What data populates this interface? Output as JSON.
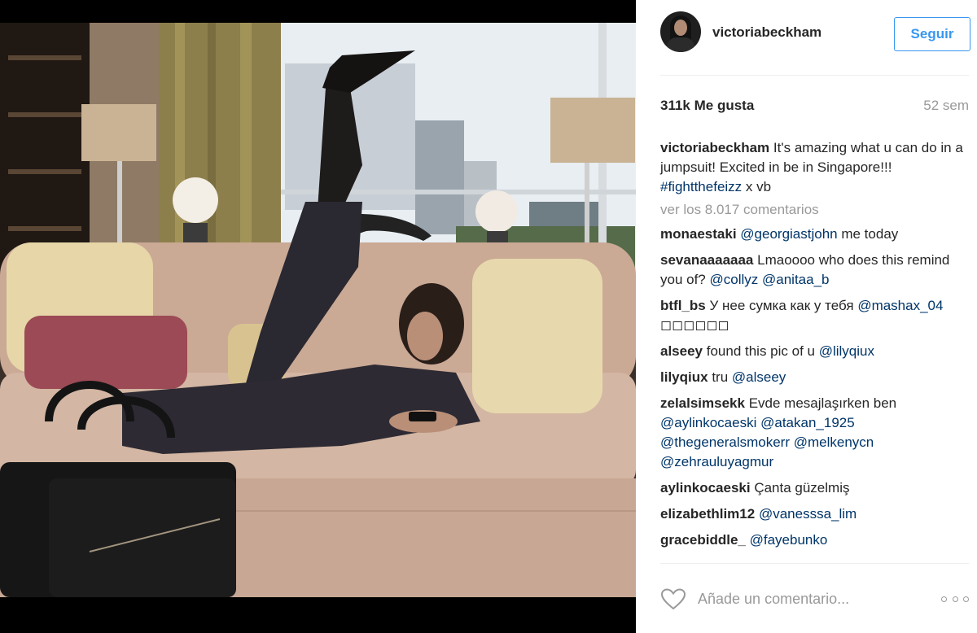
{
  "post": {
    "photo_alt": "Woman lying on a sofa with one leg raised, looking at her phone",
    "username": "victoriabeckham",
    "follow_label": "Seguir",
    "likes": "311k Me gusta",
    "time_ago": "52 sem"
  },
  "caption": {
    "username": "victoriabeckham",
    "text": "It's amazing what u can do in a jumpsuit! Excited in be in Singapore!!!",
    "hashtag": "#fightthefeizz",
    "suffix": "x vb"
  },
  "view_all_comments": "ver los 8.017 comentarios",
  "comments": [
    {
      "username": "monaestaki",
      "parts": [
        {
          "t": "@georgiastjohn",
          "link": true
        },
        {
          "t": " me today",
          "link": false
        }
      ]
    },
    {
      "username": "sevanaaaaaaa",
      "parts": [
        {
          "t": "Lmaoooo who does this remind you of? ",
          "link": false
        },
        {
          "t": "@collyz",
          "link": true
        },
        {
          "t": " ",
          "link": false
        },
        {
          "t": "@anitaa_b",
          "link": true
        }
      ]
    },
    {
      "username": "btfl_bs",
      "parts": [
        {
          "t": "У нее сумка как у тебя ",
          "link": false
        },
        {
          "t": "@mashax_04",
          "link": true
        },
        {
          "t": " ◻◻◻◻◻◻",
          "link": false
        }
      ]
    },
    {
      "username": "alseey",
      "parts": [
        {
          "t": "found this pic of u ",
          "link": false
        },
        {
          "t": "@lilyqiux",
          "link": true
        }
      ]
    },
    {
      "username": "lilyqiux",
      "parts": [
        {
          "t": "tru ",
          "link": false
        },
        {
          "t": "@alseey",
          "link": true
        }
      ]
    },
    {
      "username": "zelalsimsekk",
      "parts": [
        {
          "t": "Evde mesajlaşırken ben ",
          "link": false
        },
        {
          "t": "@aylinkocaeski",
          "link": true
        },
        {
          "t": " ",
          "link": false
        },
        {
          "t": "@atakan_1925",
          "link": true
        },
        {
          "t": " ",
          "link": false
        },
        {
          "t": "@thegeneralsmokerr",
          "link": true
        },
        {
          "t": " ",
          "link": false
        },
        {
          "t": "@melkenycn",
          "link": true
        },
        {
          "t": " ",
          "link": false
        },
        {
          "t": "@zehrauluyagmur",
          "link": true
        }
      ]
    },
    {
      "username": "aylinkocaeski",
      "parts": [
        {
          "t": "Çanta güzelmiş",
          "link": false
        }
      ]
    },
    {
      "username": "elizabethlim12",
      "parts": [
        {
          "t": "@vanesssa_lim",
          "link": true
        }
      ]
    },
    {
      "username": "gracebiddle_",
      "parts": [
        {
          "t": "@fayebunko",
          "link": true
        }
      ]
    }
  ],
  "footer": {
    "comment_placeholder": "Añade un comentario...",
    "like_icon": "heart-outline-icon",
    "more_icon": "more-options-icon"
  },
  "colors": {
    "link": "#003569",
    "accent": "#3897f0",
    "muted": "#999999"
  }
}
